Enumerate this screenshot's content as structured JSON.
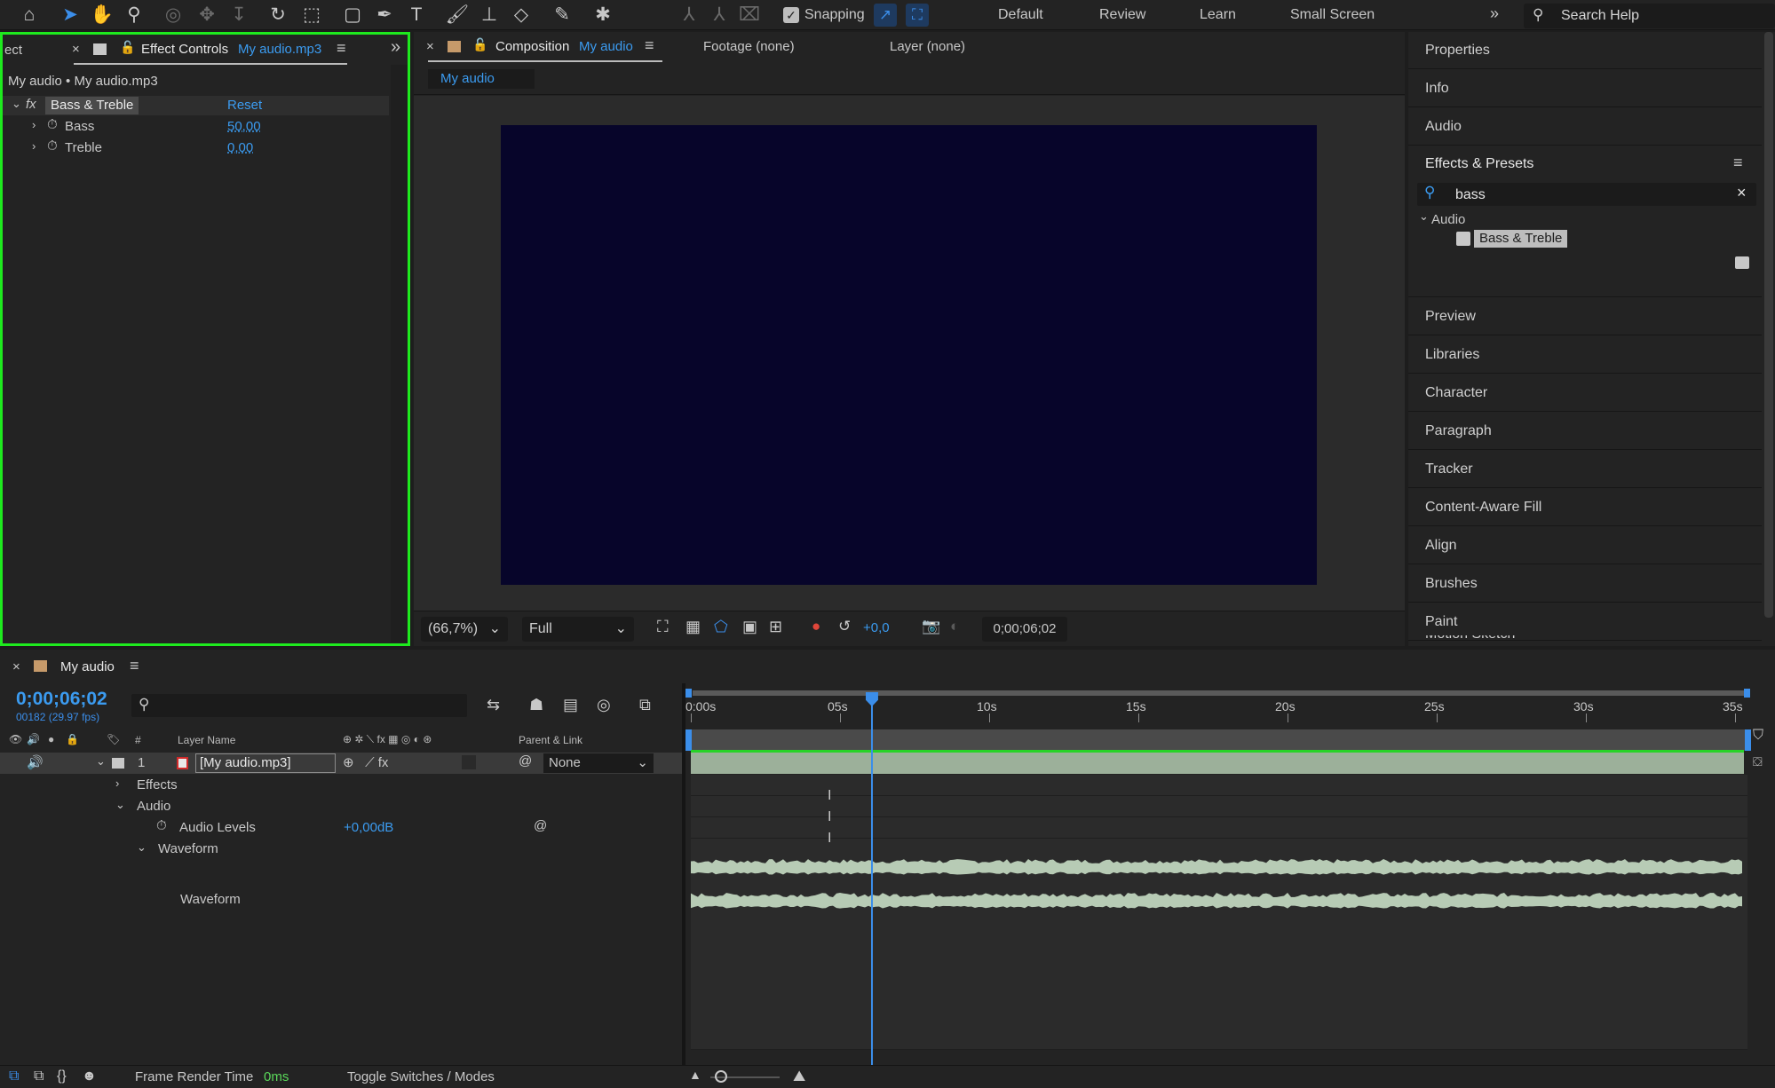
{
  "workspaces": [
    "Default",
    "Review",
    "Learn",
    "Small Screen"
  ],
  "toolbar": {
    "snapping_label": "Snapping",
    "search_placeholder": "Search Help"
  },
  "effect_controls": {
    "partial_tab": "ect",
    "tab_title": "Effect Controls",
    "tab_source": "My audio.mp3",
    "breadcrumb": "My audio • My audio.mp3",
    "effect_name": "Bass & Treble",
    "reset_label": "Reset",
    "params": [
      {
        "name": "Bass",
        "value": "50,00"
      },
      {
        "name": "Treble",
        "value": "0,00"
      }
    ]
  },
  "composition": {
    "tab_title": "Composition",
    "tab_source": "My audio",
    "footage_tab": "Footage (none)",
    "layer_tab": "Layer (none)",
    "comp_name_chip": "My audio",
    "canvas_color": "#07052a",
    "zoom": "(66,7%)",
    "resolution": "Full",
    "exposure": "+0,0",
    "timecode": "0;00;06;02"
  },
  "right_panel": {
    "items_top": [
      "Properties",
      "Info",
      "Audio"
    ],
    "effects_presets": {
      "title": "Effects & Presets",
      "search_value": "bass",
      "category": "Audio",
      "result": "Bass & Treble"
    },
    "items_bottom": [
      "Preview",
      "Libraries",
      "Character",
      "Paragraph",
      "Tracker",
      "Content-Aware Fill",
      "Align",
      "Brushes",
      "Paint",
      "Motion Sketch"
    ]
  },
  "timeline": {
    "comp_name": "My audio",
    "timecode": "0;00;06;02",
    "frame_info": "00182 (29.97 fps)",
    "col_hash": "#",
    "col_layer_name": "Layer Name",
    "col_parent": "Parent & Link",
    "layer": {
      "number": "1",
      "name": "[My audio.mp3]",
      "parent": "None"
    },
    "props": {
      "effects": "Effects",
      "audio": "Audio",
      "audio_levels": "Audio Levels",
      "audio_levels_value": "+0,00dB",
      "waveform_group": "Waveform",
      "waveform": "Waveform"
    },
    "ruler": [
      "0:00s",
      "05s",
      "10s",
      "15s",
      "20s",
      "25s",
      "30s",
      "35s"
    ],
    "playhead_seconds": 6.07,
    "duration_seconds": 35.5
  },
  "status": {
    "render_label": "Frame Render Time",
    "render_value": "0ms",
    "toggle": "Toggle Switches / Modes"
  }
}
